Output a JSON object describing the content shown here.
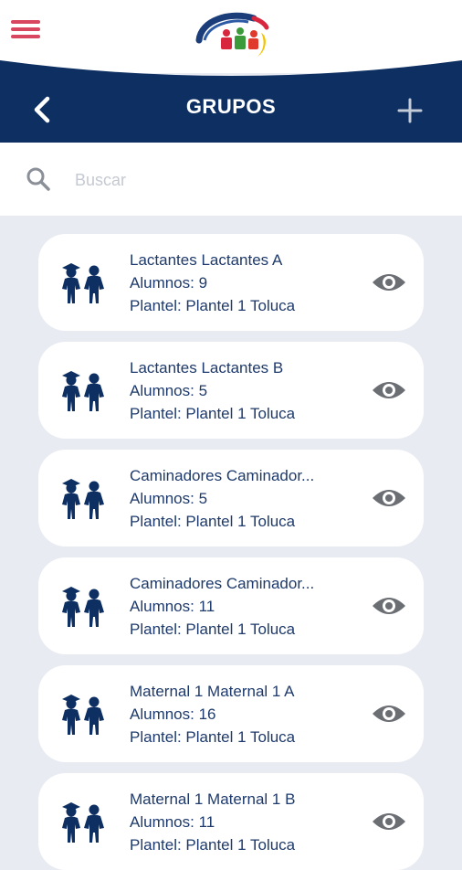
{
  "header": {
    "title": "GRUPOS",
    "colors": {
      "navy": "#0d2f62",
      "menu_red": "#d9465f"
    },
    "icons": {
      "menu": "hamburger-menu-icon",
      "back": "chevron-left-icon",
      "add": "plus-icon"
    }
  },
  "search": {
    "placeholder": "Buscar",
    "value": ""
  },
  "groups": [
    {
      "name": "Lactantes Lactantes A",
      "alumnos": "Alumnos: 9",
      "plantel": "Plantel: Plantel 1 Toluca"
    },
    {
      "name": "Lactantes Lactantes B",
      "alumnos": "Alumnos: 5",
      "plantel": "Plantel: Plantel 1 Toluca"
    },
    {
      "name": "Caminadores Caminador...",
      "alumnos": "Alumnos: 5",
      "plantel": "Plantel: Plantel 1 Toluca"
    },
    {
      "name": "Caminadores Caminador...",
      "alumnos": "Alumnos: 11",
      "plantel": "Plantel: Plantel 1 Toluca"
    },
    {
      "name": "Maternal 1 Maternal 1 A",
      "alumnos": "Alumnos: 16",
      "plantel": "Plantel: Plantel 1 Toluca"
    },
    {
      "name": "Maternal 1 Maternal 1 B",
      "alumnos": "Alumnos: 11",
      "plantel": "Plantel: Plantel 1 Toluca"
    }
  ]
}
